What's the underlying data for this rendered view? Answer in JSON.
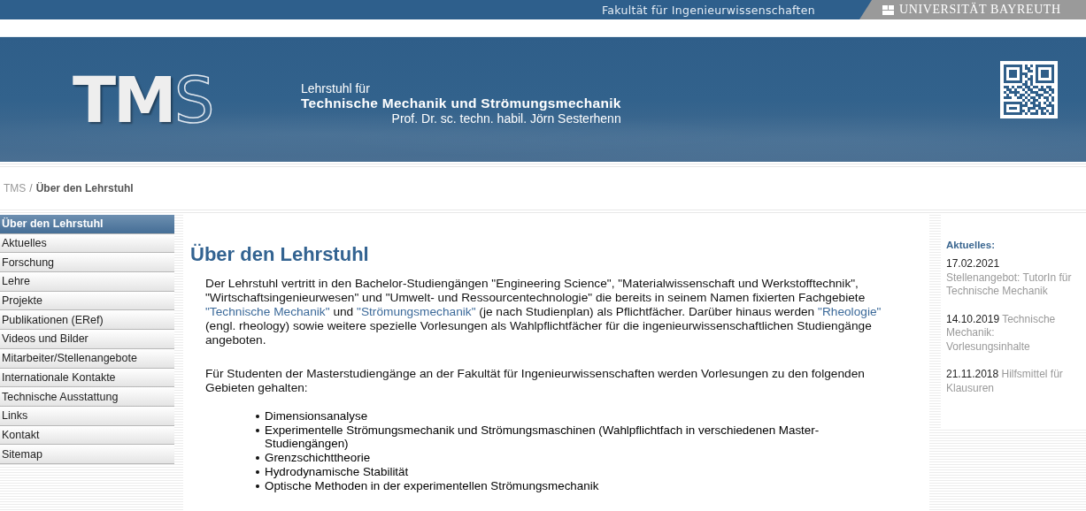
{
  "top_bar": {
    "faculty": "Fakultät für Ingenieurwissenschaften",
    "university": "UNIVERSITÄT BAYREUTH"
  },
  "banner": {
    "logo_solid": "TM",
    "logo_outline": "S",
    "line_1": "Lehrstuhl für",
    "line_2": "Technische Mechanik und Strömungsmechanik",
    "line_3": "Prof. Dr. sc. techn. habil. Jörn Sesterhenn"
  },
  "breadcrumb": [
    {
      "label": "TMS",
      "current": false
    },
    {
      "label": "Über den Lehrstuhl",
      "current": true
    }
  ],
  "breadcrumb_separator": "/",
  "sidebar": {
    "items": [
      {
        "label": "Über den Lehrstuhl",
        "selected": true
      },
      {
        "label": "Aktuelles",
        "selected": false
      },
      {
        "label": "Forschung",
        "selected": false
      },
      {
        "label": "Lehre",
        "selected": false
      },
      {
        "label": "Projekte",
        "selected": false
      },
      {
        "label": "Publikationen (ERef)",
        "selected": false
      },
      {
        "label": "Videos und Bilder",
        "selected": false
      },
      {
        "label": "Mitarbeiter/Stellenangebote",
        "selected": false
      },
      {
        "label": "Internationale Kontakte",
        "selected": false
      },
      {
        "label": "Technische Ausstattung",
        "selected": false
      },
      {
        "label": "Links",
        "selected": false
      },
      {
        "label": "Kontakt",
        "selected": false
      },
      {
        "label": "Sitemap",
        "selected": false
      }
    ]
  },
  "content": {
    "title": "Über den Lehrstuhl",
    "paragraphs": [
      [
        {
          "text": "Der Lehrstuhl vertritt in den Bachelor-Studiengängen \"Engineering Science\", \"Materialwissenschaft und Werkstofftechnik\", \"Wirtschaftsingenieurwesen\" und \"Umwelt- und Ressourcentechnologie\" die bereits in seinem Namen fixierten Fachgebiete ",
          "link": false
        },
        {
          "text": "\"Technische Mechanik\"",
          "link": true
        },
        {
          "text": " und ",
          "link": false
        },
        {
          "text": "\"Strömungsmechanik\"",
          "link": true
        },
        {
          "text": " (je nach Studienplan) als Pflichtfächer. Darüber hinaus werden ",
          "link": false
        },
        {
          "text": "\"Rheologie\"",
          "link": true
        },
        {
          "text": " (engl. rheology) sowie weitere spezielle Vorlesungen als Wahlpflichtfächer für die ingenieurwissenschaftlichen Studiengänge angeboten.",
          "link": false
        }
      ],
      [
        {
          "text": "Für Studenten der Masterstudiengänge an der Fakultät für Ingenieurwissenschaften werden Vorlesungen zu den folgenden Gebieten gehalten:",
          "link": false
        }
      ]
    ],
    "list": [
      "Dimensionsanalyse",
      "Experimentelle Strömungsmechanik und Strömungsmaschinen (Wahlpflichtfach in verschiedenen Master-Studiengängen)",
      "Grenzschichttheorie",
      "Hydrodynamische Stabilität",
      "Optische Methoden in der experimentellen Strömungsmechanik"
    ]
  },
  "news": {
    "title": "Aktuelles:",
    "items": [
      {
        "date": "17.02.2021",
        "text": "Stellenangebot: TutorIn für Technische Mechanik",
        "break": true
      },
      {
        "date": "14.10.2019",
        "text": "Technische Mechanik: Vorlesungsinhalte",
        "break": false
      },
      {
        "date": "21.11.2018",
        "text": "Hilfsmittel für Klausuren",
        "break": false
      }
    ]
  }
}
